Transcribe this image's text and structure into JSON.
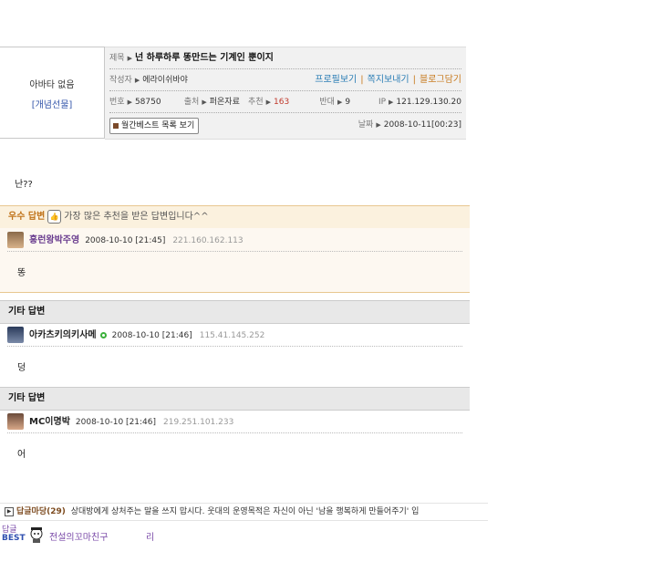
{
  "profile": {
    "no_avatar": "아바타 없음",
    "gift": "[개념선물]"
  },
  "post": {
    "title_label": "제목",
    "title": "넌 하루하루 똥만드는 기계인 뿐이지",
    "author_label": "작성자",
    "author": "에라이쉬바야",
    "profile_link": "프로필보기",
    "message_link": "쪽지보내기",
    "blog_link": "블로그담기",
    "num_label": "번호",
    "num": "58750",
    "source_label": "출처",
    "source": "퍼온자료",
    "recommend_label": "추천",
    "recommend": "163",
    "oppose_label": "반대",
    "oppose": "9",
    "ip_label": "IP",
    "ip": "121.129.130.20",
    "monthly_best_button": "월간베스트 목록 보기",
    "date_label": "날짜",
    "date": "2008-10-11[00:23]",
    "body": "난??"
  },
  "best_answer": {
    "label": "우수 답변",
    "desc": "가장 많은 추천을 받은 답변입니다^^",
    "user": "홍런왕박주영",
    "time": "2008-10-10 [21:45]",
    "ip": "221.160.162.113",
    "body": "똥"
  },
  "other_answers": [
    {
      "header": "기타 답변",
      "user": "아카츠키의키사메",
      "time": "2008-10-10 [21:46]",
      "ip": "115.41.145.252",
      "body": "덩"
    },
    {
      "header": "기타 답변",
      "user": "MC이명박",
      "time": "2008-10-10 [21:46]",
      "ip": "219.251.101.233",
      "body": "어"
    }
  ],
  "footer": {
    "section": "답글마당(29)",
    "notice": "상대방에게 상처주는 말을 쓰지 맙시다. 웃대의 운영목적은 자신이 아닌 '남을 행복하게 만들어주기' 입",
    "best_label_top": "답글",
    "best_label_bottom": "BEST",
    "best_user": "전설의꼬마친구",
    "best_text": "리"
  },
  "colors": {
    "link_blue": "#2a7db5",
    "link_orange": "#c87a1e",
    "best_bg": "#fbf1de",
    "header_gray": "#e8e8e8"
  }
}
